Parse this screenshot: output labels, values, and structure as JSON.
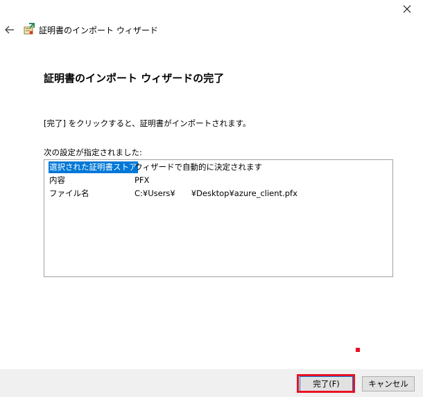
{
  "window": {
    "title": "証明書のインポート ウィザード",
    "close_glyph": "✕"
  },
  "nav": {
    "back_glyph": "←"
  },
  "page": {
    "title": "証明書のインポート ウィザードの完了",
    "instruction": "[完了] をクリックすると、証明書がインポートされます。",
    "settings_label": "次の設定が指定されました:"
  },
  "settings": [
    {
      "key": "選択された証明書ストア",
      "value": "ウィザードで自動的に決定されます",
      "selected": true
    },
    {
      "key": "内容",
      "value": "PFX",
      "selected": false
    },
    {
      "key": "ファイル名",
      "value": "C:¥Users¥　　¥Desktop¥azure_client.pfx",
      "selected": false
    }
  ],
  "buttons": {
    "finish": "完了(F)",
    "cancel": "キャンセル"
  },
  "colors": {
    "selection": "#0078d7",
    "highlight": "#e81123",
    "footer": "#f0f0f0"
  }
}
